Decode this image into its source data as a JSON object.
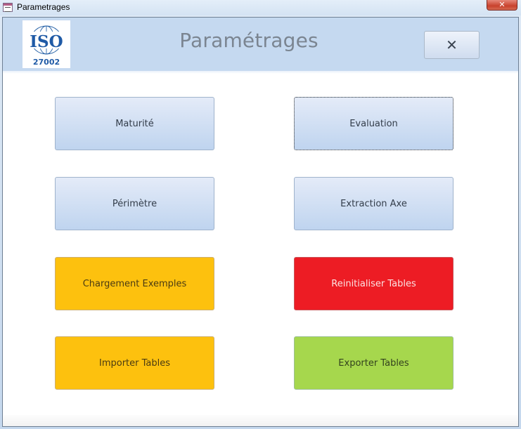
{
  "window": {
    "title": "Parametrages",
    "app_icon": "form-icon",
    "close_glyph": "✕"
  },
  "header": {
    "logo": {
      "text": "ISO",
      "subtext": "27002",
      "icon": "globe-icon"
    },
    "title": "Paramétrages",
    "close_button_glyph": "✕"
  },
  "buttons": [
    {
      "id": "maturite",
      "label": "Maturité",
      "style": "blue",
      "color": "#bfd4ef"
    },
    {
      "id": "evaluation",
      "label": "Evaluation",
      "style": "blue",
      "focused": true,
      "color": "#bfd4ef"
    },
    {
      "id": "perimetre",
      "label": "Périmètre",
      "style": "blue",
      "color": "#bfd4ef"
    },
    {
      "id": "extraction-axe",
      "label": "Extraction Axe",
      "style": "blue",
      "color": "#bfd4ef"
    },
    {
      "id": "chargement-exemples",
      "label": "Chargement Exemples",
      "style": "yellow",
      "color": "#fdc10e"
    },
    {
      "id": "reinitialiser-tables",
      "label": "Reinitialiser Tables",
      "style": "red",
      "color": "#ed1c24"
    },
    {
      "id": "importer-tables",
      "label": "Importer Tables",
      "style": "yellow",
      "color": "#fdc10e"
    },
    {
      "id": "exporter-tables",
      "label": "Exporter Tables",
      "style": "green",
      "color": "#a6d74d"
    }
  ]
}
